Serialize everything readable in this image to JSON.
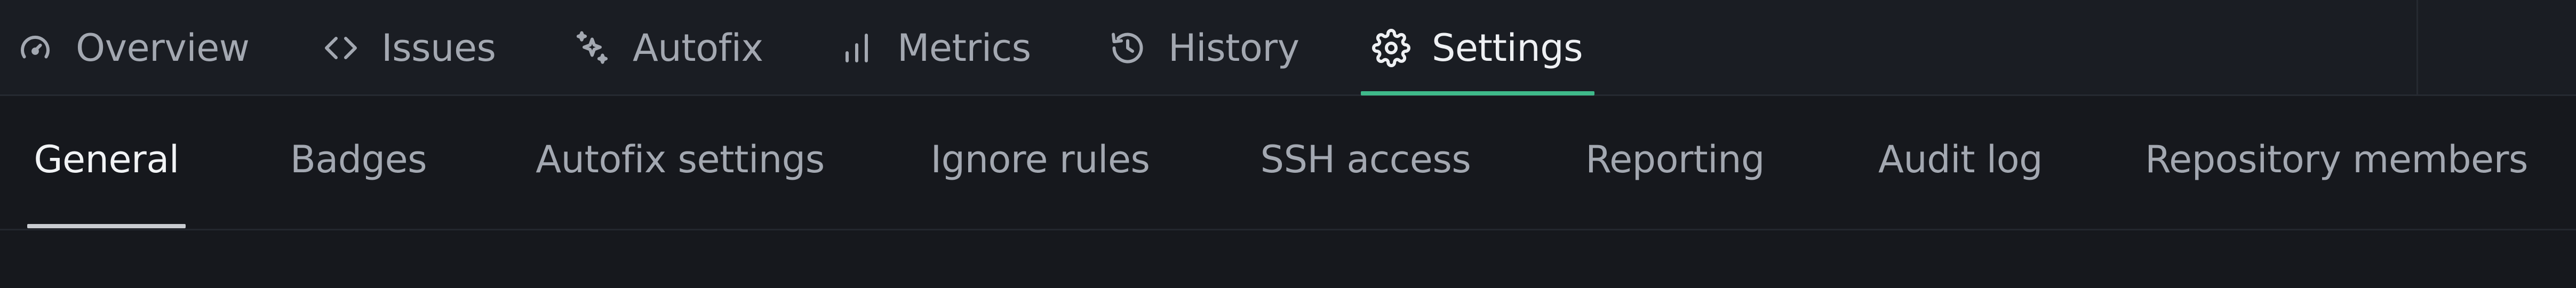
{
  "top_nav": {
    "tabs": [
      {
        "label": "Overview",
        "icon": "gauge-icon"
      },
      {
        "label": "Issues",
        "icon": "code-icon"
      },
      {
        "label": "Autofix",
        "icon": "sparkles-icon"
      },
      {
        "label": "Metrics",
        "icon": "bar-chart-icon"
      },
      {
        "label": "History",
        "icon": "history-icon"
      },
      {
        "label": "Settings",
        "icon": "gear-icon"
      }
    ],
    "active_index": 5,
    "accent_color": "#3fb98a"
  },
  "sub_nav": {
    "tabs": [
      {
        "label": "General"
      },
      {
        "label": "Badges"
      },
      {
        "label": "Autofix settings"
      },
      {
        "label": "Ignore rules"
      },
      {
        "label": "SSH access"
      },
      {
        "label": "Reporting"
      },
      {
        "label": "Audit log"
      },
      {
        "label": "Repository members"
      }
    ],
    "active_index": 0
  },
  "colors": {
    "background": "#16181d",
    "topbar_background": "#1a1d23",
    "text_muted": "#a3a8b1",
    "text_active": "#eef0f3"
  }
}
